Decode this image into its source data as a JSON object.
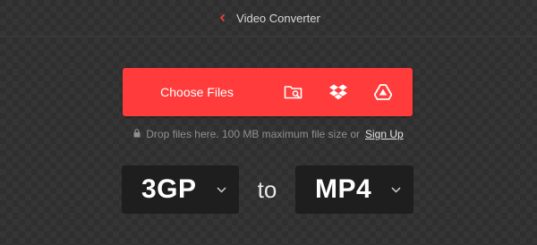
{
  "header": {
    "breadcrumb_label": "Video Converter"
  },
  "upload": {
    "choose_files_label": "Choose Files",
    "icons": [
      "folder-search-icon",
      "dropbox-icon",
      "google-drive-icon"
    ]
  },
  "hint": {
    "text": "Drop files here. 100 MB maximum file size or",
    "signup_label": "Sign Up"
  },
  "converter": {
    "from_format": "3GP",
    "to_label": "to",
    "to_format": "MP4"
  },
  "colors": {
    "accent": "#ff3b3b",
    "background": "#2f2f2f",
    "select_bg": "#1e1e1e"
  }
}
